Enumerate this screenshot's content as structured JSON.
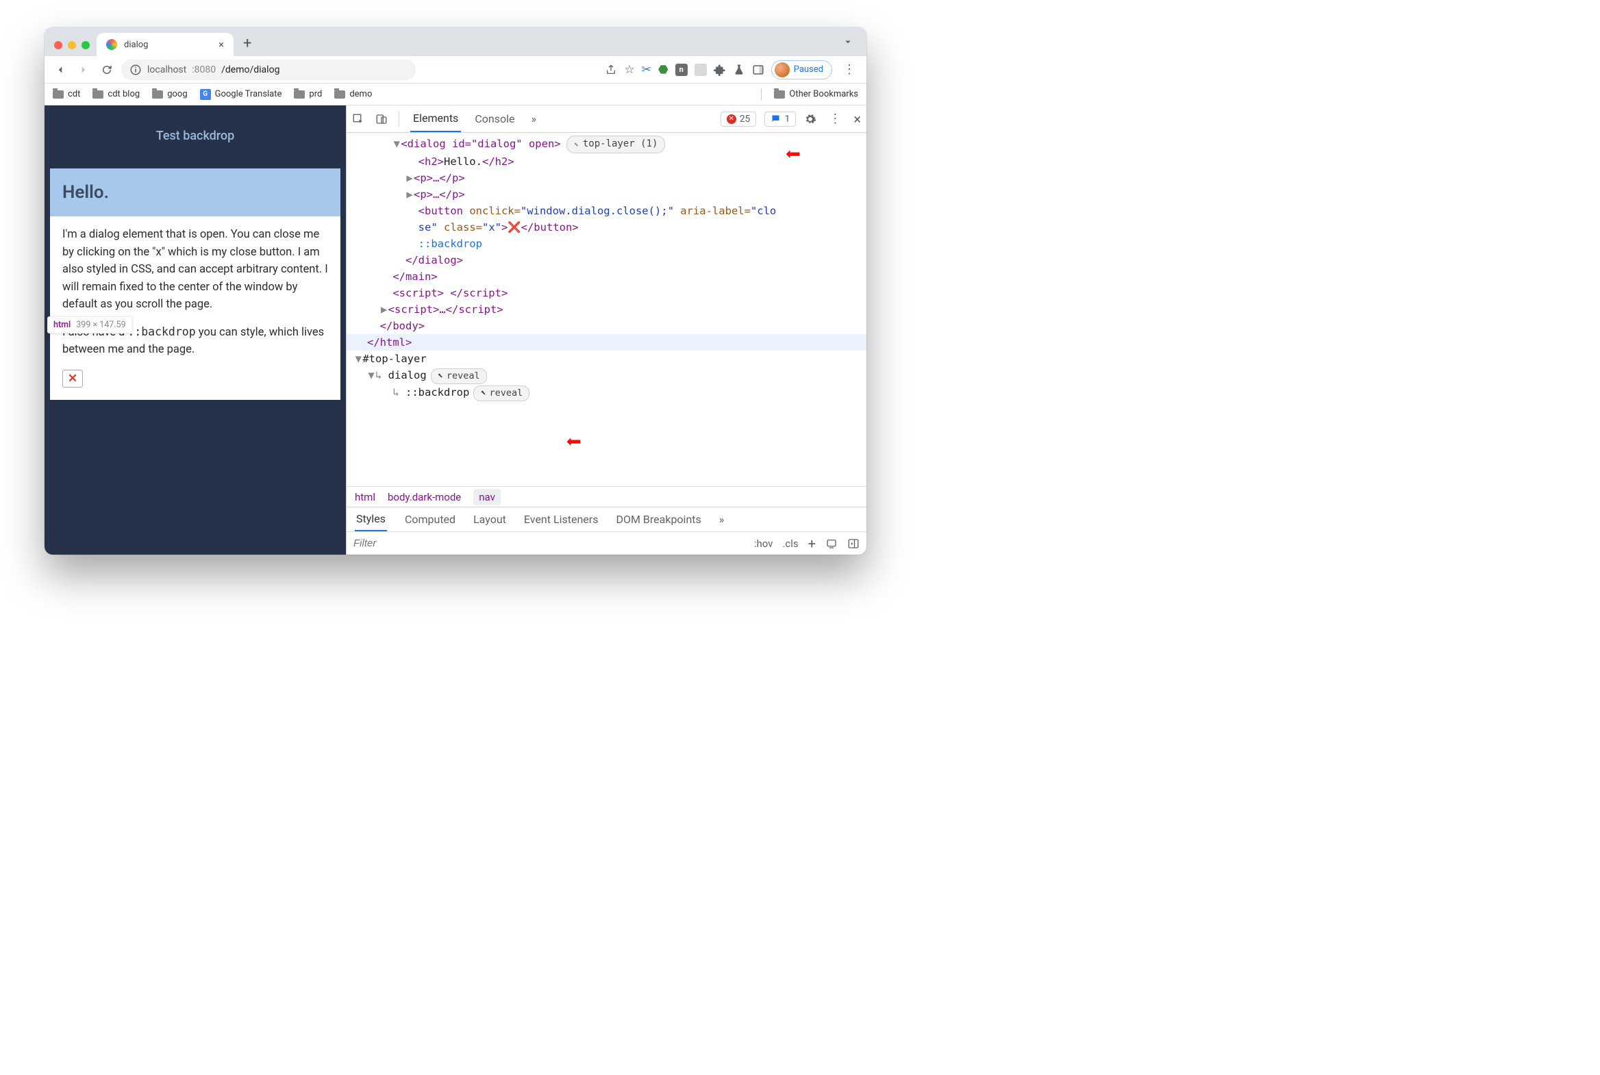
{
  "tab": {
    "title": "dialog"
  },
  "url": {
    "host": "localhost",
    "port": ":8080",
    "path": "/demo/dialog"
  },
  "profile": {
    "status": "Paused"
  },
  "bookmarks": {
    "items": [
      "cdt",
      "cdt blog",
      "goog",
      "Google Translate",
      "prd",
      "demo"
    ],
    "other": "Other Bookmarks"
  },
  "page": {
    "banner": "Test backdrop",
    "heading": "Hello.",
    "p1": "I'm a dialog element that is open. You can close me by clicking on the \"x\" which is my close button. I am also styled in CSS, and can accept arbitrary content. I will remain fixed to the center of the window by default as you scroll the page.",
    "p2a": "I also have a ",
    "p2code": "::backdrop",
    "p2b": " you can style, which lives between me and the page.",
    "close_x": "✕"
  },
  "tooltip": {
    "tag": "html",
    "dims": "399 × 147.59"
  },
  "devtools": {
    "tabs": {
      "elements": "Elements",
      "console": "Console",
      "more": "»"
    },
    "counts": {
      "errors": "25",
      "messages": "1"
    },
    "toplayer_badge": "top-layer (1)",
    "reveal": "reveal",
    "dom": {
      "dialog_open": "<dialog id=\"dialog\" open>",
      "h2o": "<h2>",
      "h2t": "Hello.",
      "h2c": "</h2>",
      "p_collapsed": "<p>…</p>",
      "button_line1a": "<button ",
      "button_attr_onclick": "onclick=",
      "button_val_onclick": "\"window.dialog.close();\"",
      "button_attr_aria": " aria-label=",
      "button_val_aria": "\"close\"",
      "button_attr_class": " class=",
      "button_val_class": "\"x\"",
      "button_gt": ">",
      "button_x": "❌",
      "button_close": "</button>",
      "backdrop": "::backdrop",
      "dialog_close": "</dialog>",
      "main_close": "</main>",
      "script_empty_a": "<script>",
      "script_empty_b": " </script>",
      "script_collapsed": "<script>…</script>",
      "body_close": "</body>",
      "html_close": "</html>",
      "toplayer_root": "#top-layer",
      "tl_dialog": "dialog",
      "tl_backdrop": "::backdrop"
    },
    "breadcrumbs": [
      "html",
      "body.dark-mode",
      "nav"
    ],
    "styles_tabs": [
      "Styles",
      "Computed",
      "Layout",
      "Event Listeners",
      "DOM Breakpoints",
      "»"
    ],
    "filter": {
      "placeholder": "Filter",
      "hov": ":hov",
      "cls": ".cls"
    }
  }
}
